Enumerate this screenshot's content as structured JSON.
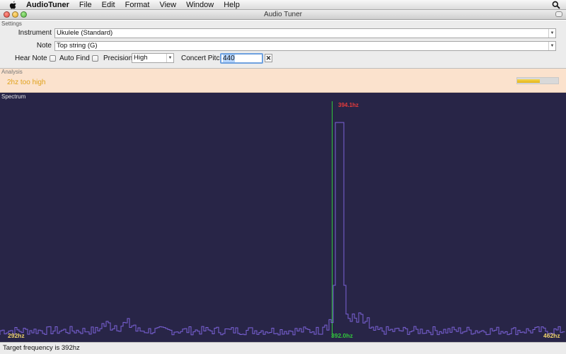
{
  "menubar": {
    "app_name": "AudioTuner",
    "items": [
      "File",
      "Edit",
      "Format",
      "View",
      "Window",
      "Help"
    ]
  },
  "window": {
    "title": "Audio Tuner"
  },
  "settings": {
    "section_label": "Settings",
    "instrument_label": "Instrument",
    "instrument_value": "Ukulele (Standard)",
    "note_label": "Note",
    "note_value": "Top string (G)",
    "hear_note_label": "Hear Note",
    "hear_note_checked": false,
    "auto_find_label": "Auto Find",
    "auto_find_checked": false,
    "precision_label": "Precision",
    "precision_value": "High",
    "concert_pitch_label": "Concert Pitch",
    "concert_pitch_value": "440"
  },
  "analysis": {
    "section_label": "Analysis",
    "message": "2hz too high",
    "meter_level": 0.55
  },
  "spectrum": {
    "section_label": "Spectrum",
    "min_label": "292hz",
    "max_label": "462hz",
    "target_label": "392.0hz",
    "peak_label": "394.1hz",
    "colors": {
      "background": "#282547",
      "trace": "#7b62d8",
      "target": "#31c83b",
      "peak": "#e73b3b",
      "axis": "#f0d36b"
    }
  },
  "status": {
    "text": "Target frequency is 392hz"
  }
}
